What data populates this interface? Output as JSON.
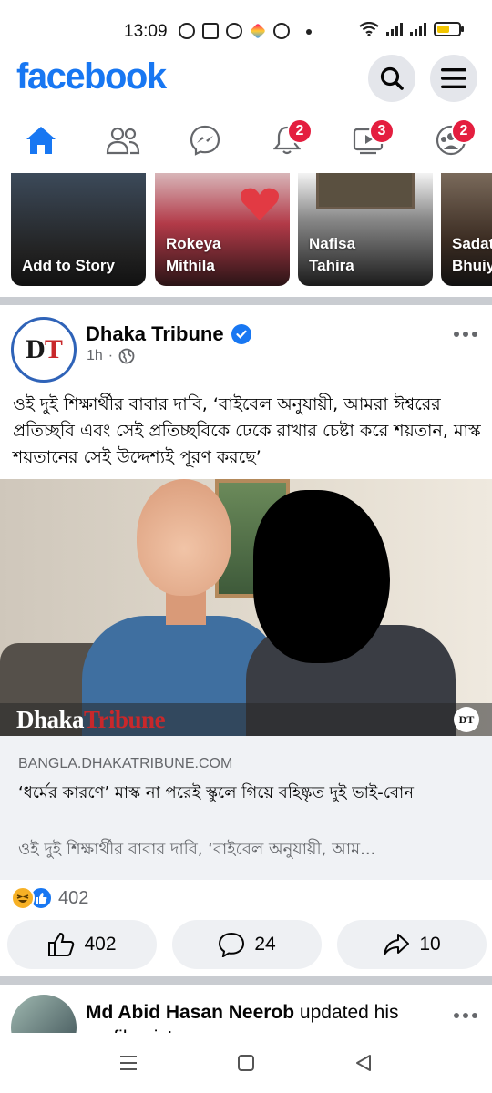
{
  "status_bar": {
    "time": "13:09"
  },
  "header": {
    "logo": "facebook"
  },
  "nav": {
    "tabs": [
      {
        "id": "home",
        "badge": null
      },
      {
        "id": "friends",
        "badge": null
      },
      {
        "id": "messenger",
        "badge": null
      },
      {
        "id": "notifications",
        "badge": "2"
      },
      {
        "id": "watch",
        "badge": "3"
      },
      {
        "id": "groups",
        "badge": "2"
      }
    ]
  },
  "stories": [
    {
      "name_line1": "Add to Story",
      "name_line2": ""
    },
    {
      "name_line1": "Rokeya",
      "name_line2": "Mithila"
    },
    {
      "name_line1": "Nafisa",
      "name_line2": "Tahira"
    },
    {
      "name_line1": "Sadat",
      "name_line2": "Bhuiy"
    }
  ],
  "post": {
    "avatar_text_d": "D",
    "avatar_text_t": "T",
    "page_name": "Dhaka Tribune",
    "time": "1h",
    "separator": "·",
    "text": "ওই দুই শিক্ষার্থীর বাবার দাবি, ‘বাইবেল অনুযায়ী, আমরা ঈশ্বরের প্রতিচ্ছবি এবং সেই প্রতিচ্ছবিকে ঢেকে রাখার চেষ্টা করে শয়তান, মাস্ক শয়তানের সেই উদ্দেশ্যই পূরণ করছে’",
    "image": {
      "brand_part1": "Dhaka",
      "brand_part2": "Tribune",
      "badge": "DT"
    },
    "link": {
      "domain": "BANGLA.DHAKATRIBUNE.COM",
      "title": "‘ধর্মের কারণে’ মাস্ক না পরেই স্কুলে গিয়ে বহিষ্কৃত দুই ভাই-বোন",
      "description": "ওই দুই শিক্ষার্থীর বাবার দাবি, ‘বাইবেল অনুযায়ী, আম..."
    },
    "reaction_count": "402",
    "actions": {
      "like_count": "402",
      "comment_count": "24",
      "share_count": "10"
    }
  },
  "next_post": {
    "author": "Md Abid Hasan Neerob",
    "text": " updated his profile picture."
  },
  "colors": {
    "brand": "#1877f2",
    "badge": "#e41e3f",
    "separator": "#c9ccd1"
  }
}
